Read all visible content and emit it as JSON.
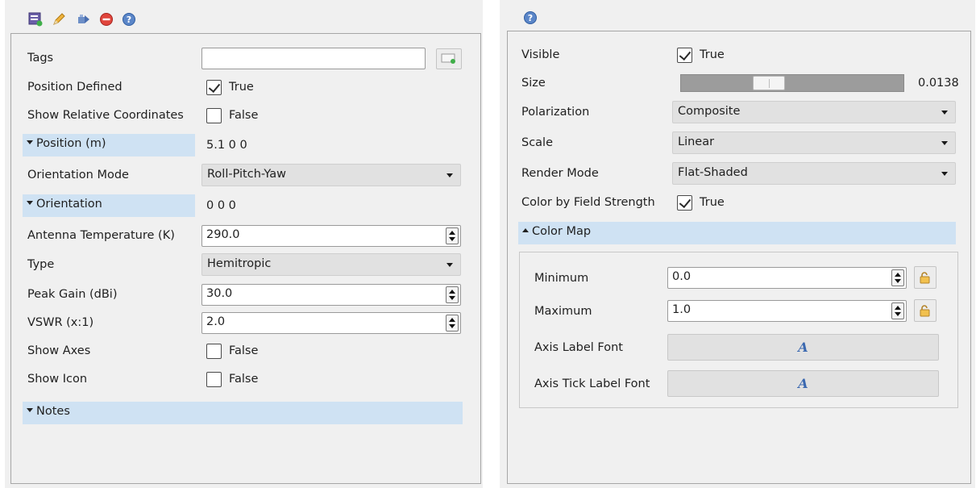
{
  "left": {
    "fields": {
      "tags_label": "Tags",
      "tags_value": "",
      "position_defined_label": "Position Defined",
      "position_defined_value": "True",
      "show_relative_label": "Show Relative Coordinates",
      "show_relative_value": "False",
      "position_label": "Position (m)",
      "position_value": "5.1 0 0",
      "orientation_mode_label": "Orientation Mode",
      "orientation_mode_value": "Roll-Pitch-Yaw",
      "orientation_label": "Orientation",
      "orientation_value": "0 0 0",
      "antenna_temp_label": "Antenna Temperature (K)",
      "antenna_temp_value": "290.0",
      "type_label": "Type",
      "type_value": "Hemitropic",
      "peak_gain_label": "Peak Gain (dBi)",
      "peak_gain_value": "30.0",
      "vswr_label": "VSWR (x:1)",
      "vswr_value": "2.0",
      "show_axes_label": "Show Axes",
      "show_axes_value": "False",
      "show_icon_label": "Show Icon",
      "show_icon_value": "False",
      "notes_label": "Notes"
    }
  },
  "right": {
    "fields": {
      "visible_label": "Visible",
      "visible_value": "True",
      "size_label": "Size",
      "size_value": "0.0138",
      "polarization_label": "Polarization",
      "polarization_value": "Composite",
      "scale_label": "Scale",
      "scale_value": "Linear",
      "render_mode_label": "Render Mode",
      "render_mode_value": "Flat-Shaded",
      "color_by_label": "Color by Field Strength",
      "color_by_value": "True",
      "color_map_label": "Color Map",
      "minimum_label": "Minimum",
      "minimum_value": "0.0",
      "maximum_label": "Maximum",
      "maximum_value": "1.0",
      "axis_label_font_label": "Axis Label Font",
      "axis_tick_font_label": "Axis Tick Label Font",
      "font_glyph": "A"
    }
  },
  "colors": {
    "section_header": "#cfe2f3",
    "panel_bg": "#f0f0f0",
    "font_glyph": "#3a68b0"
  },
  "icons": {
    "toolbar_left": [
      "properties-icon",
      "pencil-icon",
      "move-icon",
      "delete-icon",
      "help-icon"
    ],
    "toolbar_right": [
      "help-icon"
    ]
  }
}
